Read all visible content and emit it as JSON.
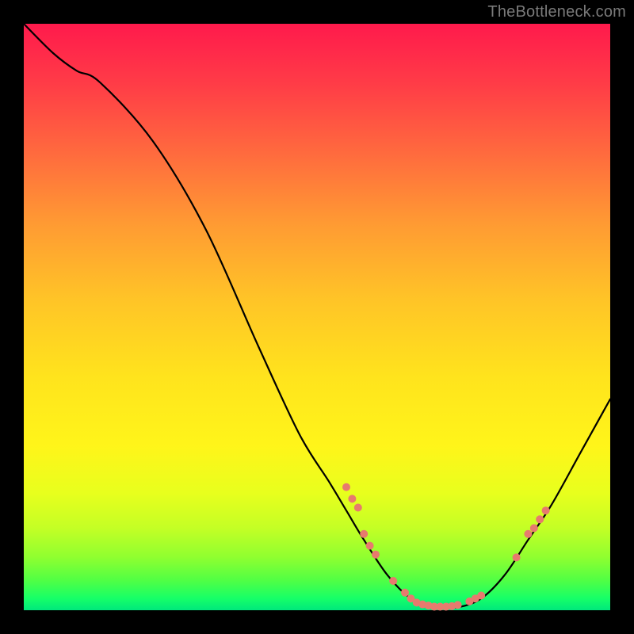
{
  "attribution": "TheBottleneck.com",
  "colors": {
    "marker": "#e77a6e",
    "curve": "#000000",
    "gradient_top": "#ff1a4c",
    "gradient_mid": "#fff51a",
    "gradient_bottom": "#00e87c"
  },
  "chart_data": {
    "type": "line",
    "title": "",
    "xlabel": "",
    "ylabel": "",
    "xlim": [
      0,
      100
    ],
    "ylim": [
      0,
      100
    ],
    "grid": false,
    "curve": [
      {
        "x": 0,
        "y": 100
      },
      {
        "x": 5,
        "y": 95
      },
      {
        "x": 9,
        "y": 92
      },
      {
        "x": 13,
        "y": 90
      },
      {
        "x": 22,
        "y": 80
      },
      {
        "x": 31,
        "y": 65
      },
      {
        "x": 40,
        "y": 45
      },
      {
        "x": 47,
        "y": 30
      },
      {
        "x": 52,
        "y": 22
      },
      {
        "x": 55,
        "y": 17
      },
      {
        "x": 58,
        "y": 12
      },
      {
        "x": 62,
        "y": 6
      },
      {
        "x": 66,
        "y": 2
      },
      {
        "x": 70,
        "y": 0.5
      },
      {
        "x": 74,
        "y": 0.5
      },
      {
        "x": 78,
        "y": 2
      },
      {
        "x": 82,
        "y": 6
      },
      {
        "x": 86,
        "y": 12
      },
      {
        "x": 90,
        "y": 18
      },
      {
        "x": 95,
        "y": 27
      },
      {
        "x": 100,
        "y": 36
      }
    ],
    "markers": [
      {
        "x": 55,
        "y": 21
      },
      {
        "x": 56,
        "y": 19
      },
      {
        "x": 57,
        "y": 17.5
      },
      {
        "x": 58,
        "y": 13
      },
      {
        "x": 59,
        "y": 11
      },
      {
        "x": 60,
        "y": 9.5
      },
      {
        "x": 63,
        "y": 5
      },
      {
        "x": 65,
        "y": 3
      },
      {
        "x": 66,
        "y": 2
      },
      {
        "x": 67,
        "y": 1.3
      },
      {
        "x": 68,
        "y": 1
      },
      {
        "x": 69,
        "y": 0.8
      },
      {
        "x": 70,
        "y": 0.6
      },
      {
        "x": 71,
        "y": 0.6
      },
      {
        "x": 72,
        "y": 0.6
      },
      {
        "x": 73,
        "y": 0.7
      },
      {
        "x": 74,
        "y": 0.9
      },
      {
        "x": 76,
        "y": 1.5
      },
      {
        "x": 77,
        "y": 2
      },
      {
        "x": 78,
        "y": 2.5
      },
      {
        "x": 84,
        "y": 9
      },
      {
        "x": 86,
        "y": 13
      },
      {
        "x": 87,
        "y": 14
      },
      {
        "x": 88,
        "y": 15.5
      },
      {
        "x": 89,
        "y": 17
      }
    ],
    "marker_radius": 5
  }
}
